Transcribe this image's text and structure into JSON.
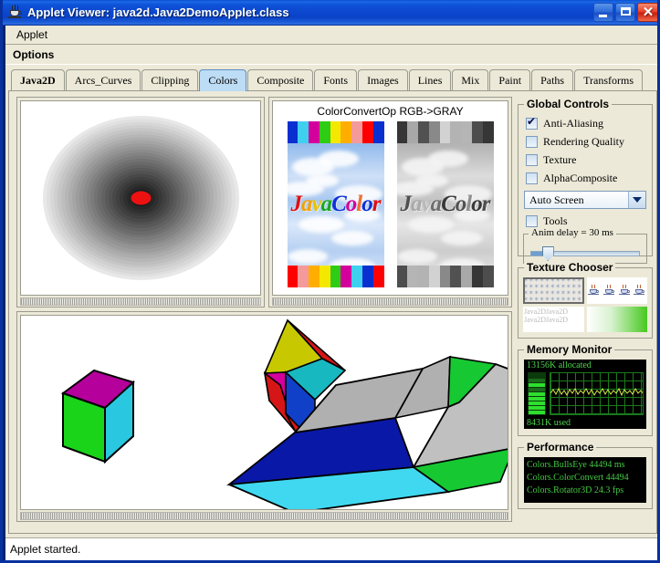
{
  "window": {
    "title": "Applet Viewer: java2d.Java2DemoApplet.class",
    "icon": "java-cup-icon",
    "buttons": {
      "minimize": "_",
      "maximize": "□",
      "close": "✕"
    }
  },
  "menubar": {
    "applet_label": "Applet"
  },
  "optionsbar": {
    "options_label": "Options"
  },
  "tabs": [
    {
      "label": "Java2D",
      "active": false,
      "bold": true
    },
    {
      "label": "Arcs_Curves",
      "active": false,
      "bold": false
    },
    {
      "label": "Clipping",
      "active": false,
      "bold": false
    },
    {
      "label": "Colors",
      "active": true,
      "bold": false
    },
    {
      "label": "Composite",
      "active": false,
      "bold": false
    },
    {
      "label": "Fonts",
      "active": false,
      "bold": false
    },
    {
      "label": "Images",
      "active": false,
      "bold": false
    },
    {
      "label": "Lines",
      "active": false,
      "bold": false
    },
    {
      "label": "Mix",
      "active": false,
      "bold": false
    },
    {
      "label": "Paint",
      "active": false,
      "bold": false
    },
    {
      "label": "Paths",
      "active": false,
      "bold": false
    },
    {
      "label": "Transforms",
      "active": false,
      "bold": false
    }
  ],
  "demos": {
    "bullseye": {
      "name": "BullsEye",
      "center_color": "#ee1111",
      "ring_outer_color": "#e8e8e8",
      "ring_inner_color": "#1a1a1a"
    },
    "colorconvert": {
      "title": "ColorConvertOp RGB->GRAY",
      "image_text": "JavaColor",
      "letters": [
        "J",
        "a",
        "v",
        "a",
        "C",
        "o",
        "l",
        "o",
        "r"
      ],
      "letter_colors": [
        "#e01010",
        "#f5a000",
        "#e8c400",
        "#1aa81a",
        "#1030d8",
        "#d4009c",
        "#f07030",
        "#1030d8",
        "#e01010"
      ],
      "bar_top_colors": [
        "#0a2fd0",
        "#3fd0ef",
        "#d4009c",
        "#2fcc16",
        "#f5e800",
        "#ffae00",
        "#f59a9a",
        "#ff0000",
        "#0a2fd0"
      ],
      "bar_bottom_colors": [
        "#ff0000",
        "#f59a9a",
        "#ffae00",
        "#f5e800",
        "#2fcc16",
        "#d4009c",
        "#3fd0ef",
        "#0a2fd0",
        "#ff0000"
      ]
    },
    "rotator3d": {
      "name": "Rotator3D",
      "cube_face_colors": [
        "#b5009c",
        "#19d419",
        "#29c8e0"
      ],
      "poly_colors": [
        "#d61616",
        "#c8c800",
        "#d4009c",
        "#18b8c0",
        "#1040c8",
        "#b0b0b0",
        "#16c832",
        "#40d8f0",
        "#0a18a8"
      ]
    }
  },
  "global_controls": {
    "legend": "Global Controls",
    "checkboxes": [
      {
        "label": "Anti-Aliasing",
        "checked": true
      },
      {
        "label": "Rendering Quality",
        "checked": false
      },
      {
        "label": "Texture",
        "checked": false
      },
      {
        "label": "AlphaComposite",
        "checked": false
      }
    ],
    "screen_combo": {
      "value": "Auto Screen"
    },
    "tools_checkbox": {
      "label": "Tools",
      "checked": false
    },
    "anim_delay": {
      "label": "Anim delay = 30 ms",
      "value": 30,
      "unit": "ms",
      "percent": 14
    }
  },
  "texture_chooser": {
    "legend": "Texture Chooser",
    "cells": [
      {
        "name": "star-texture",
        "selected": true
      },
      {
        "name": "java-cup-texture",
        "selected": false
      },
      {
        "name": "java2d-text-texture",
        "selected": false,
        "text_line1": "Java2DJava2D",
        "text_line2": "Java2DJava2D"
      },
      {
        "name": "green-gradient-texture",
        "selected": false
      }
    ]
  },
  "memory_monitor": {
    "legend": "Memory Monitor",
    "allocated": "13156K allocated",
    "used": "8431K used",
    "graph_color": "#d8e84c",
    "grid_color": "#1b7a1b"
  },
  "performance": {
    "legend": "Performance",
    "lines": [
      "Colors.BullsEye 44494 ms",
      "Colors.ColorConvert 44494",
      "Colors.Rotator3D 24.3 fps"
    ]
  },
  "statusbar": {
    "text": "Applet started."
  }
}
